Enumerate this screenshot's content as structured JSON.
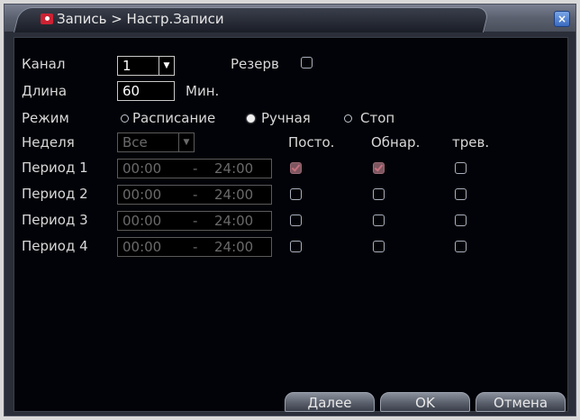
{
  "window": {
    "title": "Запись > Настр.Записи",
    "close": "×"
  },
  "form": {
    "channel_label": "Канал",
    "channel_value": "1",
    "reserve_label": "Резерв",
    "length_label": "Длина",
    "length_value": "60",
    "length_unit": "Мин.",
    "mode_label": "Режим",
    "mode_schedule": "Расписание",
    "mode_manual": "Ручная",
    "mode_stop": "Стоп",
    "week_label": "Неделя",
    "week_value": "Все",
    "dd_arrow": "▼"
  },
  "columns": {
    "constant": "Посто.",
    "motion": "Обнар.",
    "alarm": "трев."
  },
  "periods": [
    {
      "label": "Период 1",
      "start": "00:00",
      "sep": "-",
      "end": "24:00"
    },
    {
      "label": "Период 2",
      "start": "00:00",
      "sep": "-",
      "end": "24:00"
    },
    {
      "label": "Период 3",
      "start": "00:00",
      "sep": "-",
      "end": "24:00"
    },
    {
      "label": "Период 4",
      "start": "00:00",
      "sep": "-",
      "end": "24:00"
    }
  ],
  "buttons": {
    "next": "Далее",
    "ok": "OK",
    "cancel": "Отмена"
  },
  "colors": {
    "background": "#020308",
    "text": "#d8d8d8",
    "checked": "#7d5660"
  }
}
